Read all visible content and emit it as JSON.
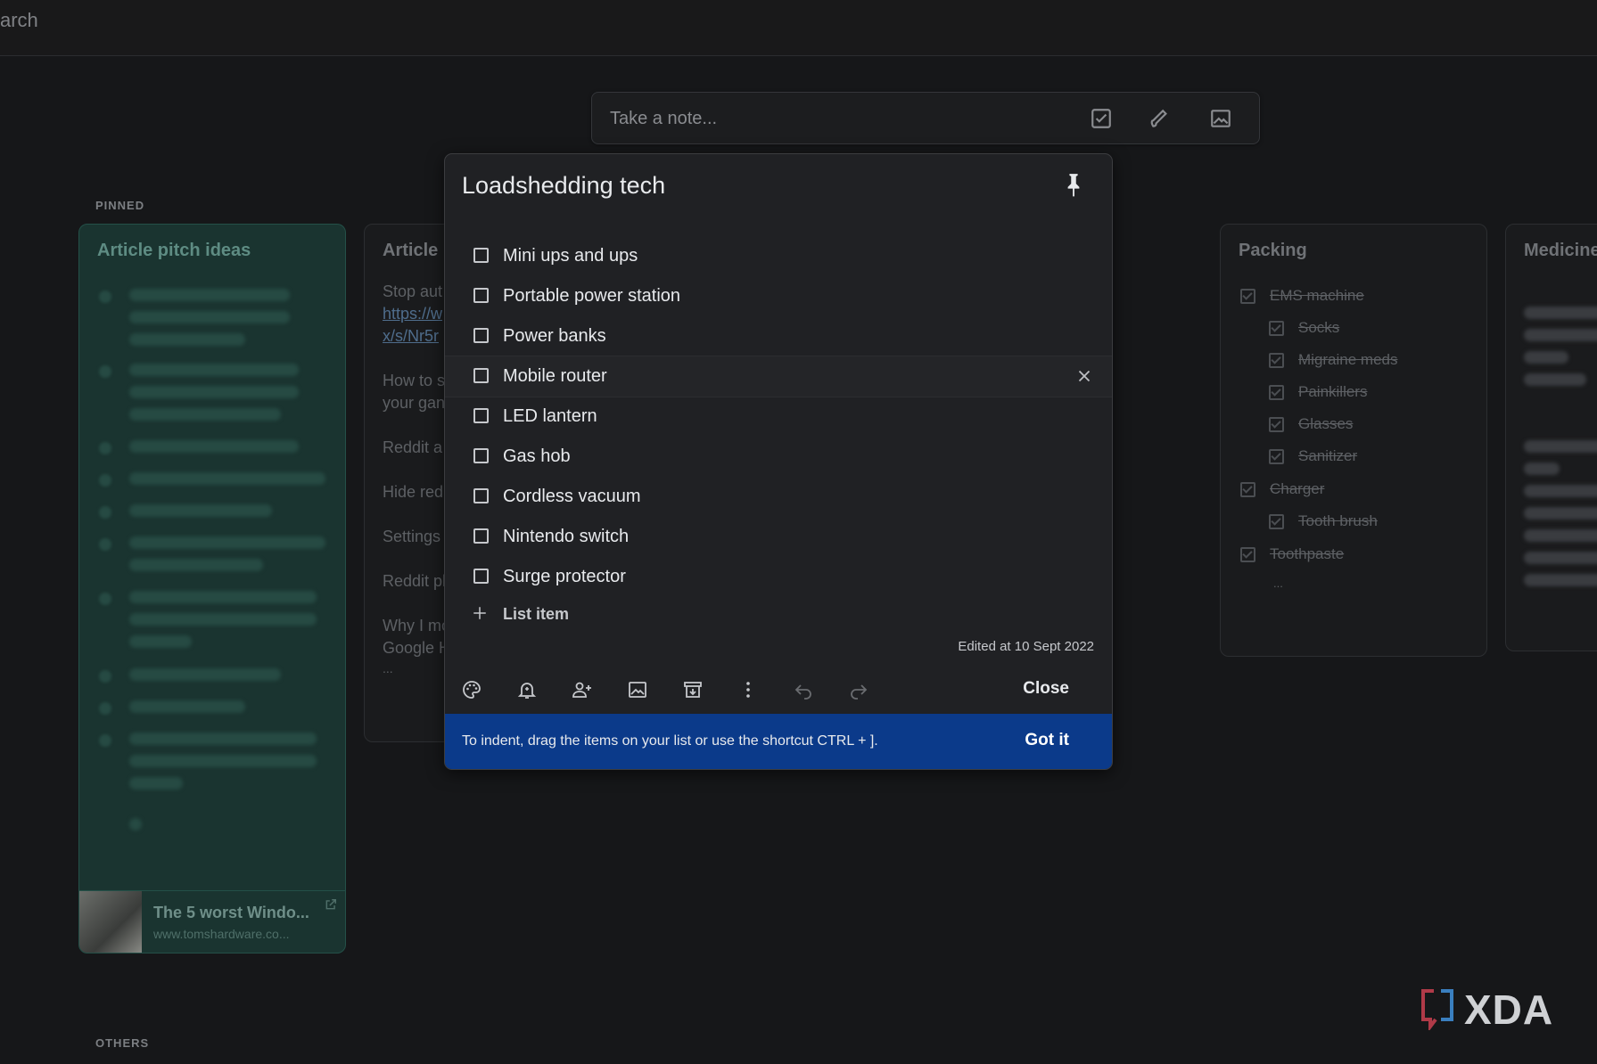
{
  "topbar": {
    "search_fragment": "arch"
  },
  "take_note": {
    "placeholder": "Take a note..."
  },
  "sections": {
    "pinned": "PINNED",
    "others": "OTHERS"
  },
  "cards": {
    "article_pitch": {
      "title": "Article pitch ideas",
      "link_title": "The 5 worst Windo...",
      "link_domain": "www.tomshardware.co..."
    },
    "article": {
      "title": "Article",
      "lines": [
        "Stop aut",
        "How to s",
        "your gan",
        "Reddit a",
        "Hide red",
        "Settings",
        "Reddit pl",
        "Why I mo",
        "Google H",
        "..."
      ],
      "links": [
        "https://w",
        "x/s/Nr5r"
      ]
    },
    "packing": {
      "title": "Packing",
      "items": [
        {
          "label": "EMS machine",
          "indent": false
        },
        {
          "label": "Socks",
          "indent": true
        },
        {
          "label": "Migraine meds",
          "indent": true
        },
        {
          "label": "Painkillers",
          "indent": true
        },
        {
          "label": "Glasses",
          "indent": true
        },
        {
          "label": "Sanitizer",
          "indent": true
        },
        {
          "label": "Charger",
          "indent": false
        },
        {
          "label": "Tooth brush",
          "indent": true
        },
        {
          "label": "Toothpaste",
          "indent": false
        }
      ],
      "more": "..."
    },
    "medicine": {
      "title": "Medicine"
    }
  },
  "modal": {
    "title": "Loadshedding tech",
    "items": [
      "Mini ups and ups",
      "Portable power station",
      "Power banks",
      "Mobile router",
      "LED lantern",
      "Gas hob",
      "Cordless vacuum",
      "Nintendo switch",
      "Surge protector"
    ],
    "add_item_label": "List item",
    "edited": "Edited at 10 Sept 2022",
    "close_label": "Close",
    "tip_text": "To indent, drag the items on your list or use the shortcut CTRL + ].",
    "got_it_label": "Got it"
  },
  "watermark": {
    "text": "XDA"
  },
  "colors": {
    "modal_bg": "#202124",
    "tip_bg": "#0b3a8a",
    "pinned_card_bg": "#1a3b35"
  }
}
